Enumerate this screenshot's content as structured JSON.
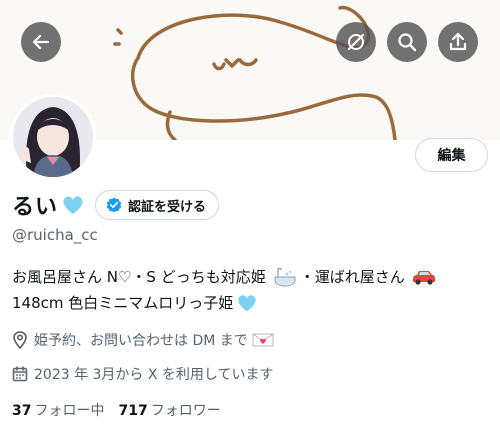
{
  "header": {
    "back_icon": "arrow-left-icon",
    "actions": [
      "mute-icon",
      "search-icon",
      "share-icon"
    ]
  },
  "profile": {
    "display_name": "るい",
    "verify_button_label": "認証を受ける",
    "edit_button_label": "編集",
    "handle": "@ruicha_cc",
    "bio_line1_a": "お風呂屋さん N♡・S どっちも対応姫",
    "bio_line1_b": "・運ばれ屋さん",
    "bio_line2": "148cm 色白ミニマムロリっ子姫",
    "location": "姫予約、お問い合わせは DM まで",
    "joined": "2023 年 3月から X を利用しています",
    "following_count": "37",
    "following_label": "フォロー中",
    "followers_count": "717",
    "followers_label": "フォロワー"
  },
  "colors": {
    "accent_blue": "#1d9bf0",
    "heart_blue": "#7fd0f5",
    "secondary_text": "#536471",
    "banner_line": "#9a6a3c"
  }
}
